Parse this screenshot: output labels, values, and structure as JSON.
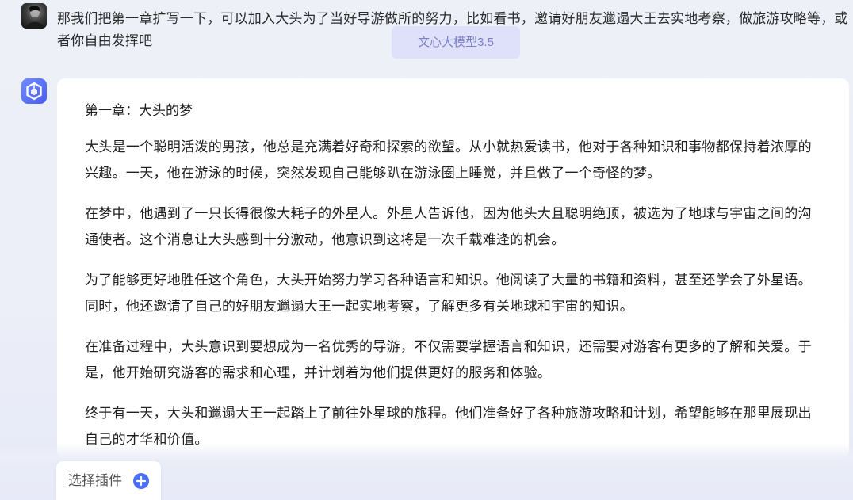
{
  "user_message": {
    "avatar_icon": "user-avatar-photo",
    "text": "那我们把第一章扩写一下，可以加入大头为了当好导游做所的努力，比如看书，邀请好朋友邋遢大王去实地考察，做旅游攻略等，或者你自由发挥吧"
  },
  "model_chip": {
    "label": "文心大模型3.5"
  },
  "bot_message": {
    "avatar_icon": "ernie-bot-logo-icon",
    "chapter_title": "第一章：大头的梦",
    "paragraphs": [
      "大头是一个聪明活泼的男孩，他总是充满着好奇和探索的欲望。从小就热爱读书，他对于各种知识和事物都保持着浓厚的兴趣。一天，他在游泳的时候，突然发现自己能够趴在游泳圈上睡觉，并且做了一个奇怪的梦。",
      "在梦中，他遇到了一只长得很像大耗子的外星人。外星人告诉他，因为他头大且聪明绝顶，被选为了地球与宇宙之间的沟通使者。这个消息让大头感到十分激动，他意识到这将是一次千载难逢的机会。",
      "为了能够更好地胜任这个角色，大头开始努力学习各种语言和知识。他阅读了大量的书籍和资料，甚至还学会了外星语。同时，他还邀请了自己的好朋友邋遢大王一起实地考察，了解更多有关地球和宇宙的知识。",
      "在准备过程中，大头意识到要想成为一名优秀的导游，不仅需要掌握语言和知识，还需要对游客有更多的了解和关爱。于是，他开始研究游客的需求和心理，并计划着为他们提供更好的服务和体验。",
      "终于有一天，大头和邋遢大王一起踏上了前往外星球的旅程。他们准备好了各种旅游攻略和计划，希望能够在那里展现出自己的才华和价值。"
    ]
  },
  "plugin_selector": {
    "label": "选择插件",
    "icon": "plus-circle-icon",
    "accent_color": "#4c6ef5"
  }
}
